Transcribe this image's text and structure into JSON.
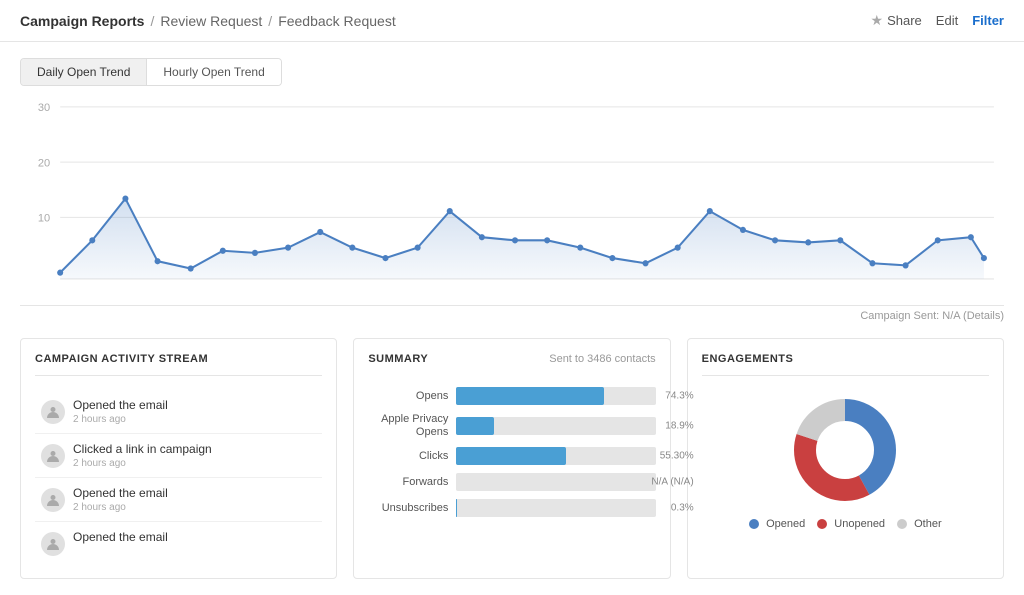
{
  "header": {
    "root_label": "Campaign Reports",
    "sep1": "/",
    "breadcrumb1": "Review Request",
    "sep2": "/",
    "breadcrumb2": "Feedback Request",
    "share_label": "Share",
    "edit_label": "Edit",
    "filter_label": "Filter"
  },
  "chart": {
    "tab1": "Daily Open Trend",
    "tab2": "Hourly Open Trend",
    "note": "Campaign Sent: N/A (Details)"
  },
  "activity": {
    "title": "CAMPAIGN ACTIVITY STREAM",
    "items": [
      {
        "text": "Opened the email",
        "time": "2 hours ago"
      },
      {
        "text": "Clicked a link in campaign",
        "time": "2 hours ago"
      },
      {
        "text": "Opened the email",
        "time": "2 hours ago"
      },
      {
        "text": "Opened the email",
        "time": ""
      }
    ]
  },
  "summary": {
    "title": "SUMMARY",
    "sent_label": "Sent to 3486 contacts",
    "rows": [
      {
        "label": "Opens",
        "value": "74.3%",
        "pct": 74.3,
        "color": "#4a9fd4"
      },
      {
        "label": "Apple Privacy Opens",
        "value": "18.9%",
        "pct": 18.9,
        "color": "#4a9fd4"
      },
      {
        "label": "Clicks",
        "value": "55.30%",
        "pct": 55,
        "color": "#4a9fd4"
      },
      {
        "label": "Forwards",
        "value": "N/A (N/A)",
        "pct": 0,
        "color": "#4a9fd4"
      },
      {
        "label": "Unsubscribes",
        "value": "0.3%",
        "pct": 0.3,
        "color": "#4a9fd4"
      }
    ]
  },
  "engagements": {
    "title": "ENGAGEMENTS",
    "donut": [
      {
        "label": "Opened",
        "color": "#4a7fc1",
        "pct": 42
      },
      {
        "label": "Unopened",
        "color": "#c94040",
        "pct": 38
      },
      {
        "label": "Other",
        "color": "#cccccc",
        "pct": 20
      }
    ]
  }
}
